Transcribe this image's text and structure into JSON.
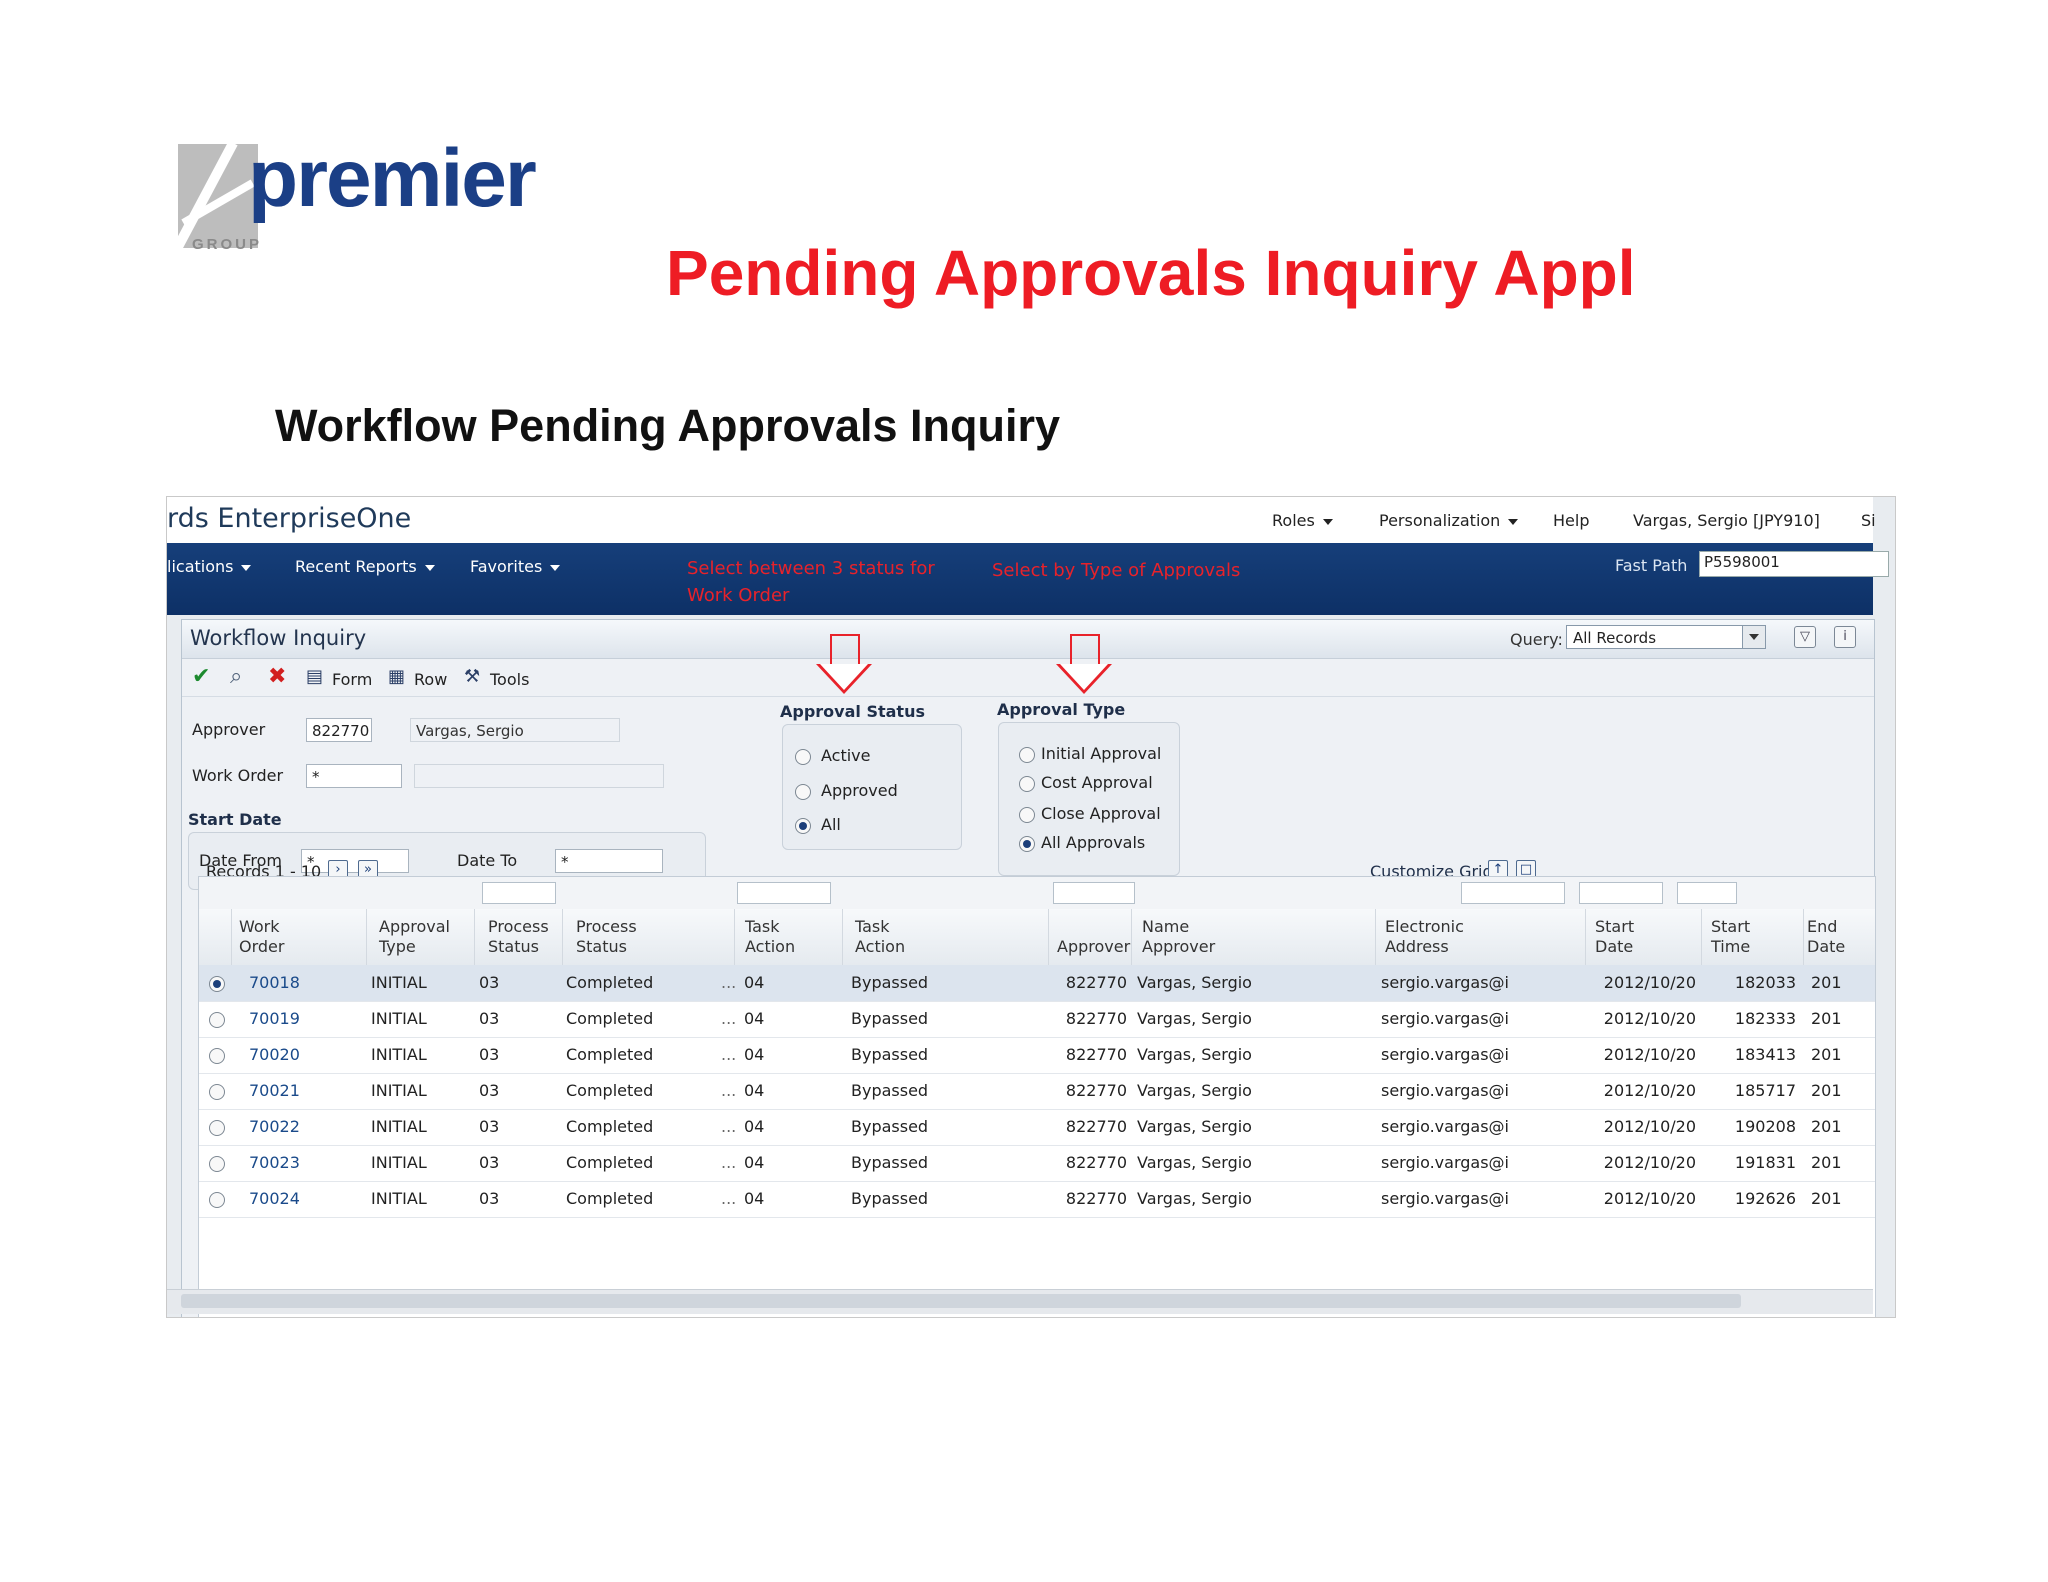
{
  "slide": {
    "logo_text": "premier",
    "logo_sub": "GROUP",
    "title": "Pending Approvals Inquiry Appl",
    "subtitle": "Workflow Pending Approvals Inquiry"
  },
  "app": {
    "brand": "rds EnterpriseOne",
    "top_nav": {
      "roles": "Roles",
      "personalization": "Personalization",
      "help": "Help",
      "user": "Vargas, Sergio  [JPY910]",
      "sign": "Si"
    },
    "menu": {
      "applications": "lications",
      "recent_reports": "Recent Reports",
      "favorites": "Favorites"
    },
    "annotations": {
      "status_note": "Select between 3 status for Work Order",
      "type_note": "Select by Type of Approvals"
    },
    "fast_path": {
      "label": "Fast Path",
      "value": "P5598001"
    }
  },
  "form": {
    "title": "Workflow Inquiry",
    "query_label": "Query:",
    "query_value": "All Records",
    "toolbar": {
      "form": "Form",
      "row": "Row",
      "tools": "Tools"
    },
    "approver_label": "Approver",
    "approver_value": "822770",
    "approver_name": "Vargas, Sergio",
    "work_order_label": "Work Order",
    "work_order_value": "*",
    "start_date_title": "Start Date",
    "date_from_label": "Date From",
    "date_from_value": "*",
    "date_to_label": "Date To",
    "date_to_value": "*",
    "approval_status": {
      "title": "Approval Status",
      "options": [
        "Active",
        "Approved",
        "All"
      ],
      "selected": "All"
    },
    "approval_type": {
      "title": "Approval Type",
      "options": [
        "Initial Approval",
        "Cost Approval",
        "Close Approval",
        "All Approvals"
      ],
      "selected": "All Approvals"
    }
  },
  "grid": {
    "records_label": "Records 1 - 10",
    "customize_label": "Customize Grid",
    "columns": [
      "Work\nOrder",
      "Approval\nType",
      "Process\nStatus",
      "Process\nStatus",
      "Task\nAction",
      "Task\nAction",
      "Approver",
      "Name\nApprover",
      "Electronic\nAddress",
      "Start\nDate",
      "Start\nTime",
      "End\nDate"
    ],
    "rows": [
      {
        "wo": "70018",
        "type": "INITIAL",
        "ps": "03",
        "psd": "Completed",
        "ta": "04",
        "tad": "Bypassed",
        "approver": "822770",
        "name": "Vargas, Sergio",
        "email": "sergio.vargas@i",
        "sdate": "2012/10/20",
        "stime": "182033",
        "edate": "201"
      },
      {
        "wo": "70019",
        "type": "INITIAL",
        "ps": "03",
        "psd": "Completed",
        "ta": "04",
        "tad": "Bypassed",
        "approver": "822770",
        "name": "Vargas, Sergio",
        "email": "sergio.vargas@i",
        "sdate": "2012/10/20",
        "stime": "182333",
        "edate": "201"
      },
      {
        "wo": "70020",
        "type": "INITIAL",
        "ps": "03",
        "psd": "Completed",
        "ta": "04",
        "tad": "Bypassed",
        "approver": "822770",
        "name": "Vargas, Sergio",
        "email": "sergio.vargas@i",
        "sdate": "2012/10/20",
        "stime": "183413",
        "edate": "201"
      },
      {
        "wo": "70021",
        "type": "INITIAL",
        "ps": "03",
        "psd": "Completed",
        "ta": "04",
        "tad": "Bypassed",
        "approver": "822770",
        "name": "Vargas, Sergio",
        "email": "sergio.vargas@i",
        "sdate": "2012/10/20",
        "stime": "185717",
        "edate": "201"
      },
      {
        "wo": "70022",
        "type": "INITIAL",
        "ps": "03",
        "psd": "Completed",
        "ta": "04",
        "tad": "Bypassed",
        "approver": "822770",
        "name": "Vargas, Sergio",
        "email": "sergio.vargas@i",
        "sdate": "2012/10/20",
        "stime": "190208",
        "edate": "201"
      },
      {
        "wo": "70023",
        "type": "INITIAL",
        "ps": "03",
        "psd": "Completed",
        "ta": "04",
        "tad": "Bypassed",
        "approver": "822770",
        "name": "Vargas, Sergio",
        "email": "sergio.vargas@i",
        "sdate": "2012/10/20",
        "stime": "191831",
        "edate": "201"
      },
      {
        "wo": "70024",
        "type": "INITIAL",
        "ps": "03",
        "psd": "Completed",
        "ta": "04",
        "tad": "Bypassed",
        "approver": "822770",
        "name": "Vargas, Sergio",
        "email": "sergio.vargas@i",
        "sdate": "2012/10/20",
        "stime": "192626",
        "edate": "201"
      }
    ]
  },
  "colors": {
    "title_red": "#ee1c24",
    "menubar_blue": "#0d3066",
    "logo_blue": "#1b3f86"
  }
}
